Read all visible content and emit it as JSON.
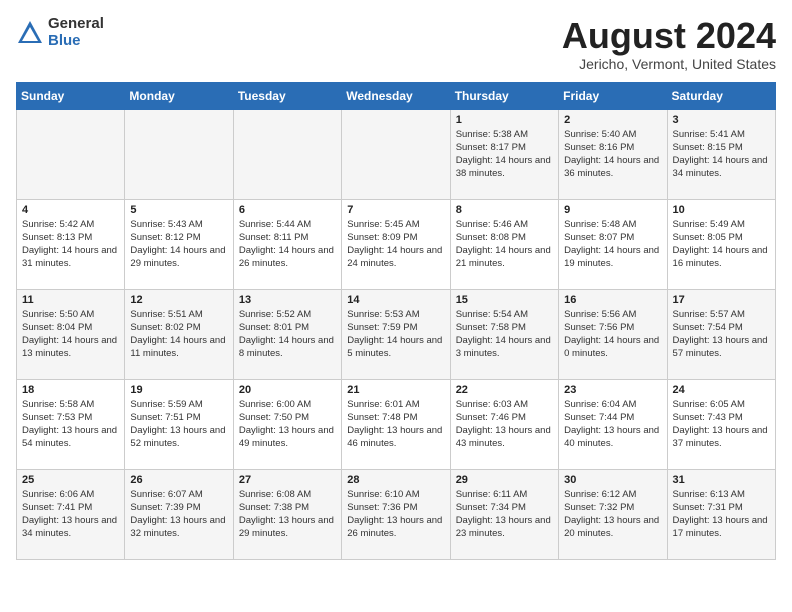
{
  "logo": {
    "general": "General",
    "blue": "Blue"
  },
  "title": "August 2024",
  "location": "Jericho, Vermont, United States",
  "days_of_week": [
    "Sunday",
    "Monday",
    "Tuesday",
    "Wednesday",
    "Thursday",
    "Friday",
    "Saturday"
  ],
  "weeks": [
    [
      {
        "day": "",
        "content": ""
      },
      {
        "day": "",
        "content": ""
      },
      {
        "day": "",
        "content": ""
      },
      {
        "day": "",
        "content": ""
      },
      {
        "day": "1",
        "content": "Sunrise: 5:38 AM\nSunset: 8:17 PM\nDaylight: 14 hours\nand 38 minutes."
      },
      {
        "day": "2",
        "content": "Sunrise: 5:40 AM\nSunset: 8:16 PM\nDaylight: 14 hours\nand 36 minutes."
      },
      {
        "day": "3",
        "content": "Sunrise: 5:41 AM\nSunset: 8:15 PM\nDaylight: 14 hours\nand 34 minutes."
      }
    ],
    [
      {
        "day": "4",
        "content": "Sunrise: 5:42 AM\nSunset: 8:13 PM\nDaylight: 14 hours\nand 31 minutes."
      },
      {
        "day": "5",
        "content": "Sunrise: 5:43 AM\nSunset: 8:12 PM\nDaylight: 14 hours\nand 29 minutes."
      },
      {
        "day": "6",
        "content": "Sunrise: 5:44 AM\nSunset: 8:11 PM\nDaylight: 14 hours\nand 26 minutes."
      },
      {
        "day": "7",
        "content": "Sunrise: 5:45 AM\nSunset: 8:09 PM\nDaylight: 14 hours\nand 24 minutes."
      },
      {
        "day": "8",
        "content": "Sunrise: 5:46 AM\nSunset: 8:08 PM\nDaylight: 14 hours\nand 21 minutes."
      },
      {
        "day": "9",
        "content": "Sunrise: 5:48 AM\nSunset: 8:07 PM\nDaylight: 14 hours\nand 19 minutes."
      },
      {
        "day": "10",
        "content": "Sunrise: 5:49 AM\nSunset: 8:05 PM\nDaylight: 14 hours\nand 16 minutes."
      }
    ],
    [
      {
        "day": "11",
        "content": "Sunrise: 5:50 AM\nSunset: 8:04 PM\nDaylight: 14 hours\nand 13 minutes."
      },
      {
        "day": "12",
        "content": "Sunrise: 5:51 AM\nSunset: 8:02 PM\nDaylight: 14 hours\nand 11 minutes."
      },
      {
        "day": "13",
        "content": "Sunrise: 5:52 AM\nSunset: 8:01 PM\nDaylight: 14 hours\nand 8 minutes."
      },
      {
        "day": "14",
        "content": "Sunrise: 5:53 AM\nSunset: 7:59 PM\nDaylight: 14 hours\nand 5 minutes."
      },
      {
        "day": "15",
        "content": "Sunrise: 5:54 AM\nSunset: 7:58 PM\nDaylight: 14 hours\nand 3 minutes."
      },
      {
        "day": "16",
        "content": "Sunrise: 5:56 AM\nSunset: 7:56 PM\nDaylight: 14 hours\nand 0 minutes."
      },
      {
        "day": "17",
        "content": "Sunrise: 5:57 AM\nSunset: 7:54 PM\nDaylight: 13 hours\nand 57 minutes."
      }
    ],
    [
      {
        "day": "18",
        "content": "Sunrise: 5:58 AM\nSunset: 7:53 PM\nDaylight: 13 hours\nand 54 minutes."
      },
      {
        "day": "19",
        "content": "Sunrise: 5:59 AM\nSunset: 7:51 PM\nDaylight: 13 hours\nand 52 minutes."
      },
      {
        "day": "20",
        "content": "Sunrise: 6:00 AM\nSunset: 7:50 PM\nDaylight: 13 hours\nand 49 minutes."
      },
      {
        "day": "21",
        "content": "Sunrise: 6:01 AM\nSunset: 7:48 PM\nDaylight: 13 hours\nand 46 minutes."
      },
      {
        "day": "22",
        "content": "Sunrise: 6:03 AM\nSunset: 7:46 PM\nDaylight: 13 hours\nand 43 minutes."
      },
      {
        "day": "23",
        "content": "Sunrise: 6:04 AM\nSunset: 7:44 PM\nDaylight: 13 hours\nand 40 minutes."
      },
      {
        "day": "24",
        "content": "Sunrise: 6:05 AM\nSunset: 7:43 PM\nDaylight: 13 hours\nand 37 minutes."
      }
    ],
    [
      {
        "day": "25",
        "content": "Sunrise: 6:06 AM\nSunset: 7:41 PM\nDaylight: 13 hours\nand 34 minutes."
      },
      {
        "day": "26",
        "content": "Sunrise: 6:07 AM\nSunset: 7:39 PM\nDaylight: 13 hours\nand 32 minutes."
      },
      {
        "day": "27",
        "content": "Sunrise: 6:08 AM\nSunset: 7:38 PM\nDaylight: 13 hours\nand 29 minutes."
      },
      {
        "day": "28",
        "content": "Sunrise: 6:10 AM\nSunset: 7:36 PM\nDaylight: 13 hours\nand 26 minutes."
      },
      {
        "day": "29",
        "content": "Sunrise: 6:11 AM\nSunset: 7:34 PM\nDaylight: 13 hours\nand 23 minutes."
      },
      {
        "day": "30",
        "content": "Sunrise: 6:12 AM\nSunset: 7:32 PM\nDaylight: 13 hours\nand 20 minutes."
      },
      {
        "day": "31",
        "content": "Sunrise: 6:13 AM\nSunset: 7:31 PM\nDaylight: 13 hours\nand 17 minutes."
      }
    ]
  ]
}
